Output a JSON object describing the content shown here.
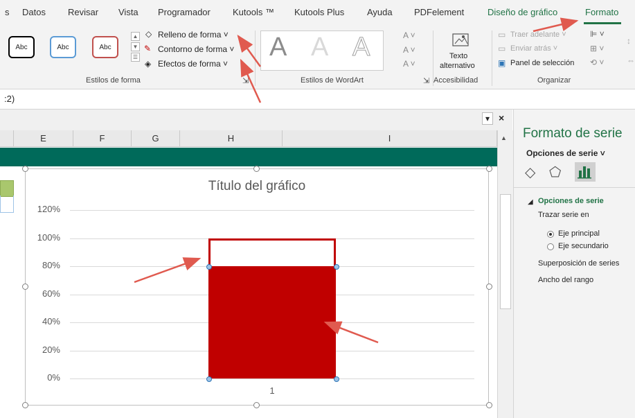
{
  "tabs": [
    {
      "label": "s"
    },
    {
      "label": "Datos"
    },
    {
      "label": "Revisar"
    },
    {
      "label": "Vista"
    },
    {
      "label": "Programador"
    },
    {
      "label": "Kutools ™"
    },
    {
      "label": "Kutools Plus"
    },
    {
      "label": "Ayuda"
    },
    {
      "label": "PDFelement"
    },
    {
      "label": "Diseño de gráfico"
    },
    {
      "label": "Formato"
    }
  ],
  "ribbon": {
    "shape_styles": [
      "Abc",
      "Abc",
      "Abc"
    ],
    "fill": "Relleno de forma ˅",
    "outline": "Contorno de forma ˅",
    "effects": "Efectos de forma ˅",
    "group_shape_styles": "Estilos de forma",
    "group_wordart": "Estilos de WordArt",
    "wordart_letter": "A",
    "alt_text_1": "Texto",
    "alt_text_2": "alternativo",
    "group_accessibility": "Accesibilidad",
    "bring_forward": "Traer adelante ˅",
    "send_backward": "Enviar atrás ˅",
    "selection_pane": "Panel de selección",
    "group_arrange": "Organizar"
  },
  "formula_bar": {
    "ref": ":2)"
  },
  "columns": [
    "E",
    "F",
    "G",
    "H",
    "I"
  ],
  "chart_data": {
    "type": "bar",
    "title": "Título del gráfico",
    "categories": [
      "1"
    ],
    "series": [
      {
        "values": [
          80
        ],
        "color": "#c00000"
      },
      {
        "values": [
          100
        ],
        "fill": "none",
        "outline": "#c00000"
      }
    ],
    "ylim": [
      0,
      120
    ],
    "yticks": [
      "0%",
      "20%",
      "40%",
      "60%",
      "80%",
      "100%",
      "120%"
    ],
    "grid": true
  },
  "panel": {
    "title": "Formato de serie",
    "subtitle": "Opciones de serie ˅",
    "section": "Opciones de serie",
    "plot_on": "Trazar serie en",
    "primary_axis": "Eje principal",
    "secondary_axis": "Eje secundario",
    "overlap": "Superposición de series",
    "gap_width": "Ancho del rango"
  },
  "colors": {
    "accent": "#217346",
    "bar": "#c00000",
    "teal": "#006a5a",
    "arrow": "#e05a4f"
  }
}
